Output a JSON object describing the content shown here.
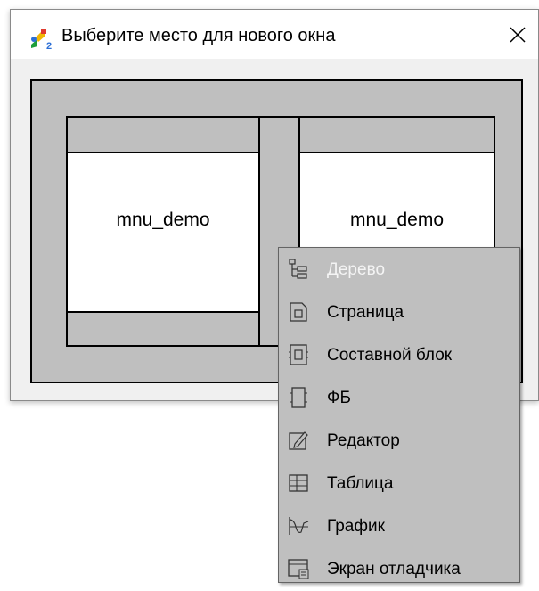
{
  "window": {
    "title": "Выберите место для нового окна",
    "close_symbol": "✕"
  },
  "layout": {
    "left_cell_label": "mnu_demo",
    "right_cell_label": "mnu_demo"
  },
  "context_menu": {
    "items": [
      {
        "label": "Дерево",
        "icon": "tree-icon",
        "enabled": false
      },
      {
        "label": "Страница",
        "icon": "page-icon",
        "enabled": true
      },
      {
        "label": "Составной блок",
        "icon": "composite-block-icon",
        "enabled": true
      },
      {
        "label": "ФБ",
        "icon": "function-block-icon",
        "enabled": true
      },
      {
        "label": "Редактор",
        "icon": "editor-icon",
        "enabled": true
      },
      {
        "label": "Таблица",
        "icon": "table-icon",
        "enabled": true
      },
      {
        "label": "График",
        "icon": "graph-icon",
        "enabled": true
      },
      {
        "label": "Экран отладчика",
        "icon": "debugger-screen-icon",
        "enabled": true
      }
    ]
  }
}
